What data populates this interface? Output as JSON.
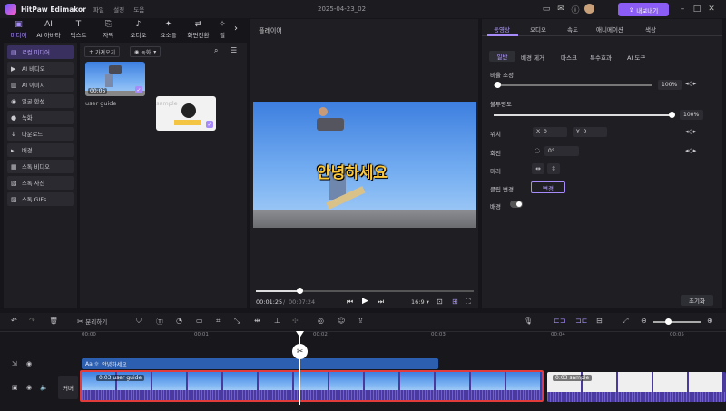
{
  "app": {
    "name": "HitPaw Edimakor",
    "menu": [
      "파일",
      "설정",
      "도움"
    ],
    "doc_title": "2025-04-23_02",
    "export_label": "내보내기"
  },
  "top_tabs": [
    {
      "icon": "▣",
      "label": "미디어"
    },
    {
      "icon": "AI",
      "label": "AI 아바타"
    },
    {
      "icon": "T",
      "label": "텍스트"
    },
    {
      "icon": "⎘",
      "label": "자막"
    },
    {
      "icon": "♪",
      "label": "오디오"
    },
    {
      "icon": "✦",
      "label": "요소들"
    },
    {
      "icon": "⇄",
      "label": "화면전환"
    },
    {
      "icon": "✧",
      "label": "필"
    }
  ],
  "sidebar": [
    {
      "icon": "▤",
      "label": "로컬 미디어"
    },
    {
      "icon": "▶",
      "label": "AI 비디오"
    },
    {
      "icon": "▥",
      "label": "AI 이미지"
    },
    {
      "icon": "◉",
      "label": "얼굴 합성"
    },
    {
      "icon": "●",
      "label": "녹화"
    },
    {
      "icon": "↓",
      "label": "다운로드"
    },
    {
      "icon": "▸",
      "label": "배경"
    },
    {
      "icon": "▦",
      "label": "스톡 비디오"
    },
    {
      "icon": "▧",
      "label": "스톡 사진"
    },
    {
      "icon": "▨",
      "label": "스톡 GIFs"
    }
  ],
  "media": {
    "import_label": "가져오기",
    "record_label": "녹화",
    "items": [
      {
        "name": "user guide",
        "duration": "00:05"
      },
      {
        "name": "sample",
        "duration": ""
      }
    ],
    "overlay_text": "안녕하세요"
  },
  "player": {
    "title": "플레이어",
    "current_time": "00:01:25",
    "total_time": "00:07:24",
    "aspect": "16:9",
    "progress": 0.2
  },
  "props": {
    "tabs": [
      "동영상",
      "오디오",
      "속도",
      "애니메이션",
      "색상"
    ],
    "subtabs": [
      "일반",
      "배경 제거",
      "마스크",
      "특수효과",
      "AI 도구"
    ],
    "scale_label": "비율 조정",
    "scale_value": "100%",
    "opacity_label": "불투명도",
    "opacity_value": "100%",
    "position_label": "위치",
    "pos_x_label": "X",
    "pos_x_value": "0",
    "pos_y_label": "Y",
    "pos_y_value": "0",
    "rotate_label": "회전",
    "rotate_value": "0°",
    "mirror_label": "미러",
    "clip_change_label": "클립 변경",
    "change_button": "변경",
    "bg_label": "배경",
    "reset_button": "초기화"
  },
  "toolbar": {
    "split_label": "분리하기"
  },
  "timeline": {
    "ruler": [
      "00:00",
      "00:01",
      "00:02",
      "00:03",
      "00:04",
      "00:05"
    ],
    "text_clip": "안녕하세요",
    "cover_label": "커버",
    "clip_main": "0:03 user guide",
    "clip_b": "0:03 sample"
  }
}
